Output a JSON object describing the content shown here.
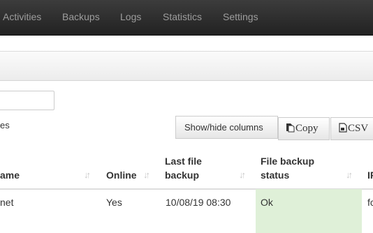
{
  "navbar": {
    "items": [
      {
        "label": "Activities"
      },
      {
        "label": "Backups"
      },
      {
        "label": "Logs"
      },
      {
        "label": "Statistics"
      },
      {
        "label": "Settings"
      }
    ]
  },
  "table_controls": {
    "entries_text": "es",
    "buttons": {
      "show_hide_columns": "Show/hide columns",
      "copy": "Copy",
      "csv": "CSV"
    }
  },
  "table": {
    "columns": [
      {
        "label": "ame"
      },
      {
        "label": "Online"
      },
      {
        "label": "Last file backup"
      },
      {
        "label": "File backup status"
      },
      {
        "label": "IP"
      }
    ],
    "rows": [
      {
        "name": "net",
        "online": "Yes",
        "last_file_backup": "10/08/19 08:30",
        "file_backup_status": "Ok",
        "ip": "fc"
      }
    ]
  },
  "colors": {
    "navbar_bg": "#222222",
    "nav_text": "#9d9d9d",
    "status_ok_bg": "#dff0d8"
  },
  "icons": {
    "sort": "sort-arrows-icon",
    "copy": "copy-document-icon",
    "csv": "csv-document-icon"
  }
}
